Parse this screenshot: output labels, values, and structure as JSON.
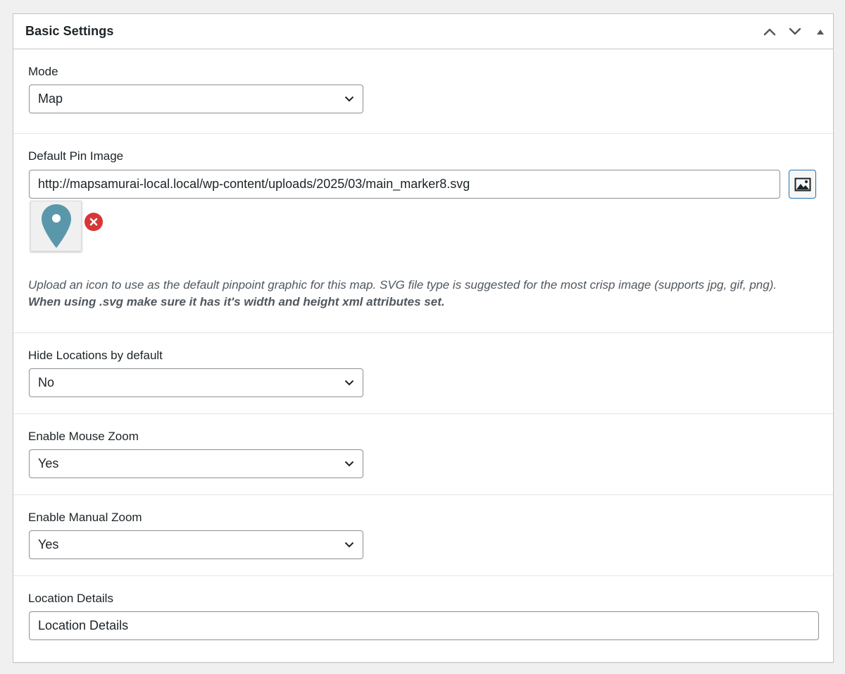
{
  "panel": {
    "title": "Basic Settings",
    "actions": {
      "move_up": "chevron-up-icon",
      "move_down": "chevron-down-icon",
      "toggle": "triangle-up-icon"
    }
  },
  "fields": {
    "mode": {
      "label": "Mode",
      "value": "Map"
    },
    "default_pin_image": {
      "label": "Default Pin Image",
      "value": "http://mapsamurai-local.local/wp-content/uploads/2025/03/main_marker8.svg",
      "pin_color": "#5b97ab",
      "description": "Upload an icon to use as the default pinpoint graphic for this map. SVG file type is suggested for the most crisp image (supports jpg, gif, png).",
      "note": "When using .svg make sure it has it's width and height xml attributes set."
    },
    "hide_locations": {
      "label": "Hide Locations by default",
      "value": "No"
    },
    "mouse_zoom": {
      "label": "Enable Mouse Zoom",
      "value": "Yes"
    },
    "manual_zoom": {
      "label": "Enable Manual Zoom",
      "value": "Yes"
    },
    "location_details": {
      "label": "Location Details",
      "value": "Location Details"
    }
  },
  "colors": {
    "accent": "#2271b1",
    "remove": "#d63638",
    "border": "#8c8f94"
  }
}
